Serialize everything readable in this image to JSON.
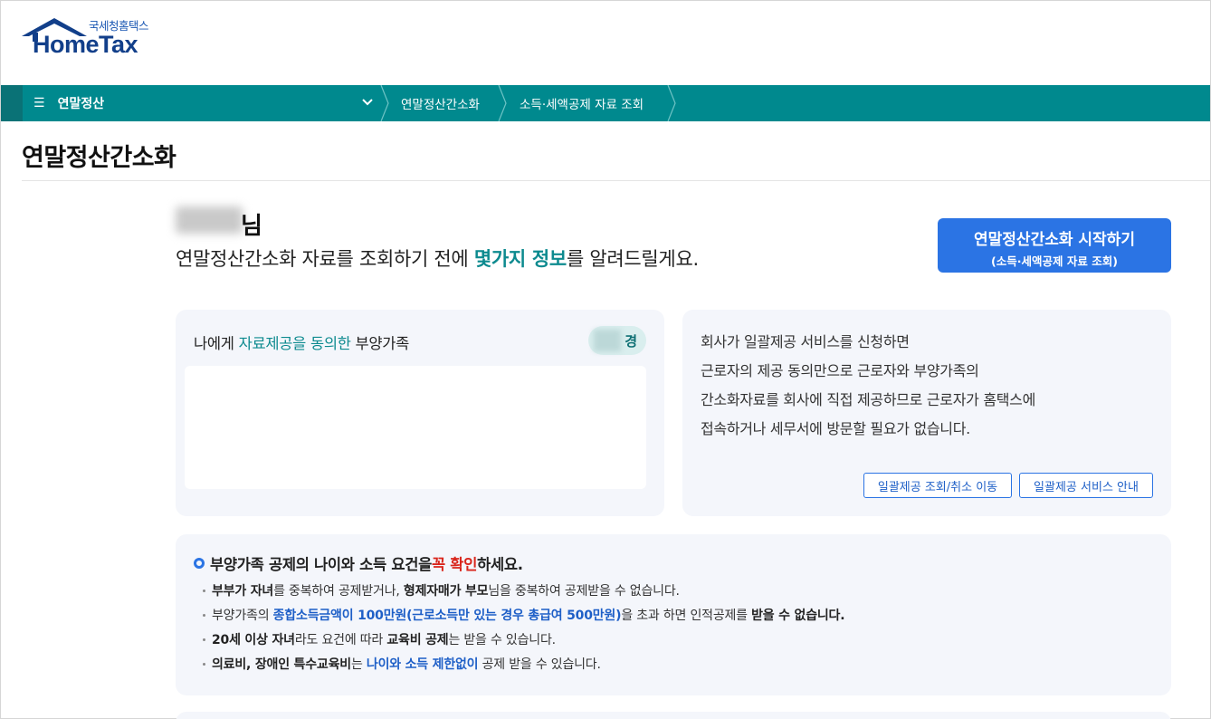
{
  "logo": {
    "subtitle": "국세청홈택스",
    "name": "HomeTax"
  },
  "nav": {
    "menu_label": "연말정산",
    "breadcrumbs": [
      "연말정산간소화",
      "소득·세액공제 자료 조회"
    ]
  },
  "page_title": "연말정산간소화",
  "greeting": {
    "name_suffix": "님",
    "line_prefix": "연말정산간소화 자료를 조회하기 전에 ",
    "line_highlight": "몇가지 정보",
    "line_suffix": "를 알려드릴게요."
  },
  "start_button": {
    "line1": "연말정산간소화 시작하기",
    "line2": "(소득·세액공제 자료 조회)"
  },
  "consent_card": {
    "title_prefix": "나에게 ",
    "title_highlight": "자료제공을 동의한",
    "title_suffix": " 부양가족",
    "pill_text": "경"
  },
  "company_card": {
    "lines": [
      "회사가 일괄제공 서비스를 신청하면",
      "근로자의 제공 동의만으로 근로자와 부양가족의",
      "간소화자료를 회사에 직접 제공하므로 근로자가 홈택스에",
      "접속하거나 세무서에 방문할 필요가 없습니다."
    ],
    "button1": "일괄제공 조회/취소 이동",
    "button2": "일괄제공 서비스 안내"
  },
  "notice_card": {
    "head_prefix": "부양가족 공제의 나이와 소득 요건을 ",
    "head_red": "꼭 확인",
    "head_suffix": "하세요.",
    "rows": {
      "r1": {
        "b1": "부부가 자녀",
        "t1": "를 중복하여 공제받거나, ",
        "b2": "형제자매가 부모",
        "t2": "님을 중복하여 공제받을 수 없습니다."
      },
      "r2": {
        "t1": "부양가족의 ",
        "blue": "종합소득금액이 100만원(근로소득만 있는 경우 총급여 500만원)",
        "t2": "을 초과 하면 인적공제를 ",
        "b1": "받을 수 없습니다."
      },
      "r3": {
        "b1": "20세 이상 자녀",
        "t1": "라도 요건에 따라 ",
        "b2": "교육비 공제",
        "t2": "는 받을 수 있습니다."
      },
      "r4": {
        "b1": "의료비, 장애인 특수교육비",
        "t1": "는 ",
        "blue": "나이와 소득 제한없이",
        "t2": " 공제 받을 수 있습니다."
      }
    }
  },
  "colors": {
    "teal": "#00898e",
    "blue": "#2b74e4",
    "red": "#d9261c"
  }
}
